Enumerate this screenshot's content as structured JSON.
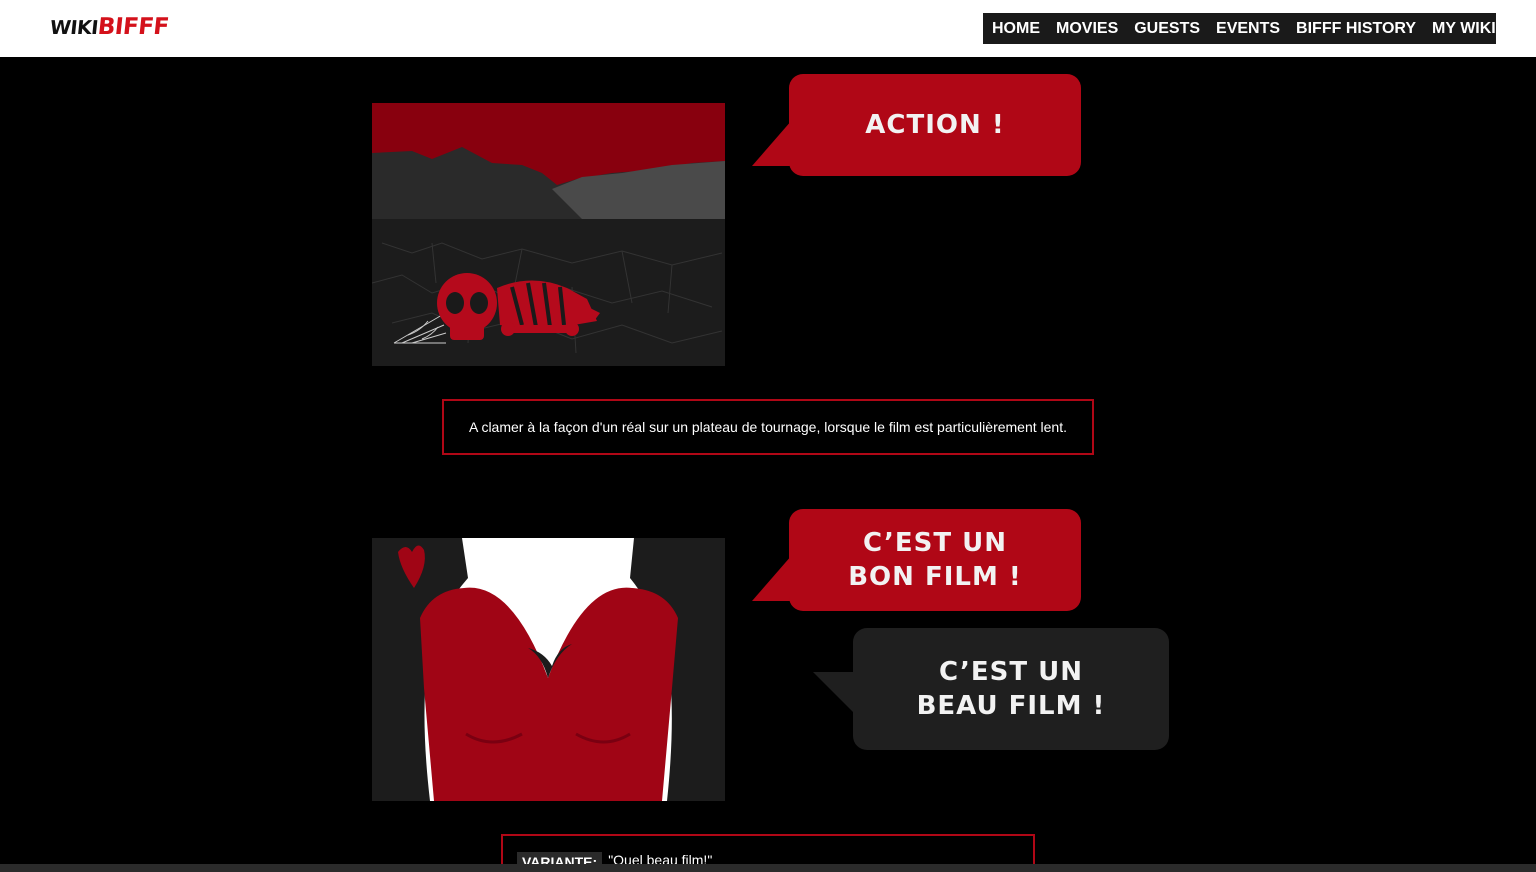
{
  "logo": {
    "part1": "WIKI",
    "part2": "BIFFF"
  },
  "nav": {
    "items": [
      "HOME",
      "MOVIES",
      "GUESTS",
      "EVENTS",
      "BIFFF HISTORY",
      "MY WIKI"
    ],
    "dropdown_caret": "▼"
  },
  "entries": [
    {
      "bubbles": [
        "ACTION !"
      ],
      "caption": "A clamer à la façon d'un réal sur un plateau de tournage, lorsque le film est particulièrement lent."
    },
    {
      "bubbles": [
        "C’EST UN\nBON FILM !",
        "C’EST UN\nBEAU FILM !"
      ],
      "variant_label": "VARIANTE:",
      "variant_text": "\"Quel beau film!\""
    }
  ],
  "colors": {
    "accent": "#b00716",
    "background": "#000000",
    "header": "#ffffff",
    "nav": "#1a1a1a",
    "dark_bubble": "#1f1f1f"
  }
}
